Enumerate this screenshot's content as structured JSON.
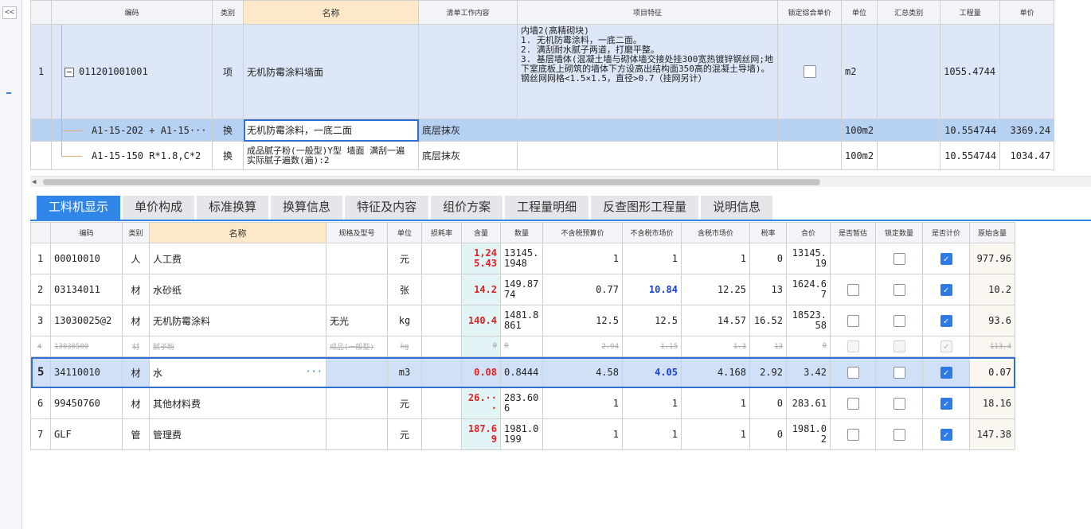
{
  "collapse_label": "<<",
  "top_grid": {
    "headers": [
      "编码",
      "类别",
      "名称",
      "清单工作内容",
      "项目特征",
      "锁定综合单价",
      "单位",
      "汇总类别",
      "工程量",
      "单价"
    ],
    "rows": [
      {
        "index": "1",
        "code": "011201001001",
        "type": "项",
        "name": "无机防霉涂料墙面",
        "work": "",
        "feature": "内墙2(高精砌块)\n1. 无机防霉涂料，一底二面。\n2. 满刮耐水腻子两道，打磨平整。\n3. 基层墙体(混凝土墙与砌体墙交接处挂300宽热镀锌钢丝网;地下室底板上砌筑的墙体下方设高出结构面350高的混凝土导墙)。钢丝网网格<1.5×1.5，直径>0.7（挂网另计）",
        "unit": "m2",
        "summary": "",
        "qty": "1055.4744",
        "price": ""
      },
      {
        "index": "",
        "code": "A1-15-202 + A1-15···",
        "type": "换",
        "name": "无机防霉涂料，一底二面",
        "work": "底层抹灰",
        "feature": "",
        "unit": "100m2",
        "summary": "",
        "qty": "10.554744",
        "price": "3369.24"
      },
      {
        "index": "",
        "code": "A1-15-150 R*1.8,C*2",
        "type": "换",
        "name": "成品腻子粉(一般型)Y型 墙面 满刮一遍 实际腻子遍数(遍):2",
        "work": "底层抹灰",
        "feature": "",
        "unit": "100m2",
        "summary": "",
        "qty": "10.554744",
        "price": "1034.47"
      }
    ]
  },
  "tabs": [
    "工料机显示",
    "单价构成",
    "标准换算",
    "换算信息",
    "特征及内容",
    "组价方案",
    "工程量明细",
    "反查图形工程量",
    "说明信息"
  ],
  "bottom_grid": {
    "headers": [
      "编码",
      "类别",
      "名称",
      "规格及型号",
      "单位",
      "损耗率",
      "含量",
      "数量",
      "不含税预算价",
      "不含税市场价",
      "含税市场价",
      "税率",
      "合价",
      "是否暂估",
      "锁定数量",
      "是否计价",
      "原始含量"
    ],
    "rows": [
      {
        "index": "1",
        "code": "00010010",
        "type": "人",
        "name": "人工费",
        "spec": "",
        "unit": "元",
        "loss": "",
        "content": "1,245.43",
        "qty": "13145.1948",
        "budget": "1",
        "market": "1",
        "market_tax": "1",
        "tax": "0",
        "total": "13145.19",
        "orig": "977.96"
      },
      {
        "index": "2",
        "code": "03134011",
        "type": "材",
        "name": "水砂纸",
        "spec": "",
        "unit": "张",
        "loss": "",
        "content": "14.2",
        "qty": "149.8774",
        "budget": "0.77",
        "market": "10.84",
        "market_tax": "12.25",
        "tax": "13",
        "total": "1624.67",
        "orig": "10.2"
      },
      {
        "index": "3",
        "code": "13030025@2",
        "type": "材",
        "name": "无机防霉涂料",
        "spec": "无光",
        "unit": "kg",
        "loss": "",
        "content": "140.4",
        "qty": "1481.8861",
        "budget": "12.5",
        "market": "12.5",
        "market_tax": "14.57",
        "tax": "16.52",
        "total": "18523.58",
        "orig": "93.6"
      },
      {
        "index": "4",
        "code": "13030500",
        "type": "材",
        "name": "腻子粉",
        "spec": "成品(一般型)",
        "unit": "kg",
        "loss": "",
        "content": "0",
        "qty": "0",
        "budget": "2.94",
        "market": "1.15",
        "market_tax": "1.3",
        "tax": "13",
        "total": "0",
        "orig": "113.4"
      },
      {
        "index": "5",
        "code": "34110010",
        "type": "材",
        "name": "水",
        "spec": "",
        "unit": "m3",
        "loss": "",
        "content": "0.08",
        "qty": "0.8444",
        "budget": "4.58",
        "market": "4.05",
        "market_tax": "4.168",
        "tax": "2.92",
        "total": "3.42",
        "orig": "0.07"
      },
      {
        "index": "6",
        "code": "99450760",
        "type": "材",
        "name": "其他材料费",
        "spec": "",
        "unit": "元",
        "loss": "",
        "content": "26.···",
        "qty": "283.606",
        "budget": "1",
        "market": "1",
        "market_tax": "1",
        "tax": "0",
        "total": "283.61",
        "orig": "18.16"
      },
      {
        "index": "7",
        "code": "GLF",
        "type": "管",
        "name": "管理费",
        "spec": "",
        "unit": "元",
        "loss": "",
        "content": "187.69",
        "qty": "1981.0199",
        "budget": "1",
        "market": "1",
        "market_tax": "1",
        "tax": "0",
        "total": "1981.02",
        "orig": "147.38"
      }
    ]
  },
  "colors": {
    "accent": "#2f85e8",
    "selection": "#b7d1f3",
    "header_highlight": "#fde9c9",
    "content_red": "#e02020",
    "market_blue": "#1a3fd8"
  }
}
